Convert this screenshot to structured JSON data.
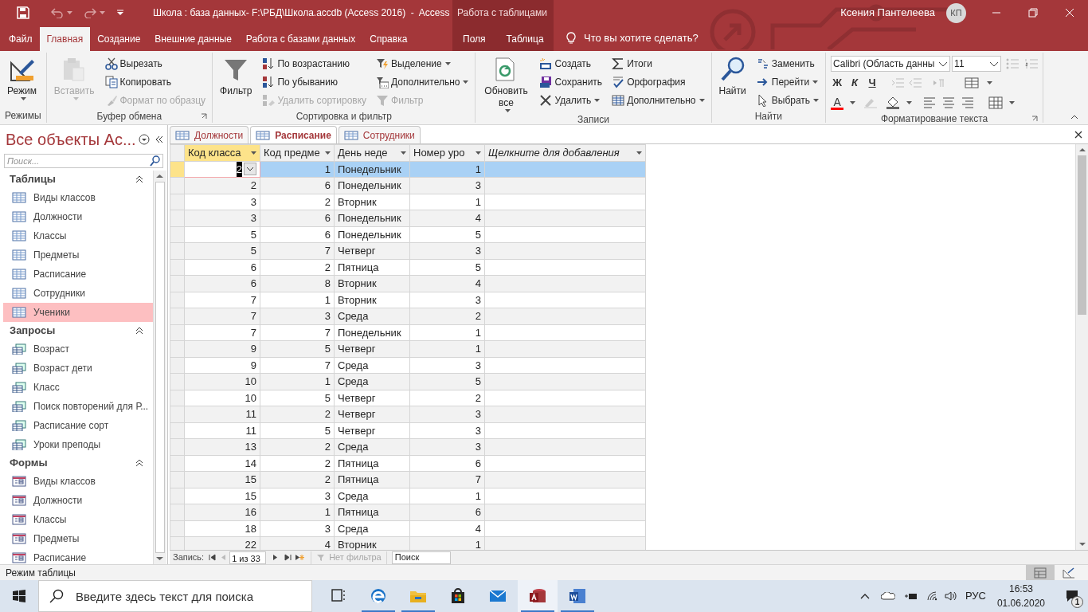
{
  "title_bar": {
    "title": "Школа : база данных- F:\\РБД\\Школа.accdb (Access 2016)  -  Access",
    "context_label": "Работа с таблицами",
    "user": "Ксения Пантелеева",
    "avatar": "КП"
  },
  "ribbon_tabs": [
    {
      "label": "Файл",
      "selected": false,
      "context": false
    },
    {
      "label": "Главная",
      "selected": true,
      "context": false
    },
    {
      "label": "Создание",
      "selected": false,
      "context": false
    },
    {
      "label": "Внешние данные",
      "selected": false,
      "context": false
    },
    {
      "label": "Работа с базами данных",
      "selected": false,
      "context": false
    },
    {
      "label": "Справка",
      "selected": false,
      "context": false
    },
    {
      "label": "Поля",
      "selected": false,
      "context": true
    },
    {
      "label": "Таблица",
      "selected": false,
      "context": true
    }
  ],
  "tell_me": "Что вы хотите сделать?",
  "ribbon_groups": [
    {
      "title": "Режимы",
      "launcher": false,
      "columns": [
        [
          {
            "label": "Режим",
            "kind": "large",
            "dropdown": true,
            "disabled": false
          }
        ]
      ]
    },
    {
      "title": "Буфер обмена",
      "launcher": true,
      "columns": [
        [
          {
            "label": "Вставить",
            "kind": "large",
            "dropdown": true,
            "disabled": true
          }
        ],
        [
          {
            "label": "Вырезать",
            "kind": "small",
            "dropdown": false,
            "disabled": false
          },
          {
            "label": "Копировать",
            "kind": "small",
            "dropdown": false,
            "disabled": false
          },
          {
            "label": "Формат по образцу",
            "kind": "small",
            "dropdown": false,
            "disabled": true
          }
        ]
      ]
    },
    {
      "title": "Сортировка и фильтр",
      "launcher": false,
      "columns": [
        [
          {
            "label": "Фильтр",
            "kind": "large",
            "dropdown": false,
            "disabled": false
          }
        ],
        [
          {
            "label": "По возрастанию",
            "kind": "small",
            "dropdown": false,
            "disabled": false
          },
          {
            "label": "По убыванию",
            "kind": "small",
            "dropdown": false,
            "disabled": false
          },
          {
            "label": "Удалить сортировку",
            "kind": "small",
            "dropdown": false,
            "disabled": true
          }
        ],
        [
          {
            "label": "Выделение",
            "kind": "small",
            "dropdown": true,
            "disabled": false
          },
          {
            "label": "Дополнительно",
            "kind": "small",
            "dropdown": true,
            "disabled": false
          },
          {
            "label": "Фильтр",
            "kind": "small",
            "dropdown": false,
            "disabled": true
          }
        ]
      ]
    },
    {
      "title": "Записи",
      "launcher": false,
      "columns": [
        [
          {
            "label": "Обновить все",
            "kind": "large",
            "dropdown": true,
            "disabled": false
          }
        ],
        [
          {
            "label": "Создать",
            "kind": "small",
            "dropdown": false,
            "disabled": false
          },
          {
            "label": "Сохранить",
            "kind": "small",
            "dropdown": false,
            "disabled": false
          },
          {
            "label": "Удалить",
            "kind": "small",
            "dropdown": true,
            "disabled": false
          }
        ],
        [
          {
            "label": "Итоги",
            "kind": "small",
            "dropdown": false,
            "disabled": false
          },
          {
            "label": "Орфография",
            "kind": "small",
            "dropdown": false,
            "disabled": false
          },
          {
            "label": "Дополнительно",
            "kind": "small",
            "dropdown": true,
            "disabled": false
          }
        ]
      ]
    },
    {
      "title": "Найти",
      "launcher": false,
      "columns": [
        [
          {
            "label": "Найти",
            "kind": "large",
            "dropdown": false,
            "disabled": false
          }
        ],
        [
          {
            "label": "Заменить",
            "kind": "small",
            "dropdown": false,
            "disabled": false
          },
          {
            "label": "Перейти",
            "kind": "small",
            "dropdown": true,
            "disabled": false
          },
          {
            "label": "Выбрать",
            "kind": "small",
            "dropdown": true,
            "disabled": false
          }
        ]
      ]
    }
  ],
  "format_group": {
    "title": "Форматирование текста",
    "launcher": true,
    "font": "Calibri (Область данны",
    "size": "11",
    "style_buttons": [
      "Ж",
      "К",
      "Ч"
    ],
    "font_color": {
      "label": "A",
      "color": "#ff0000"
    }
  },
  "navigation_pane": {
    "title": "Все объекты Ac...",
    "search_placeholder": "Поиск...",
    "groups": [
      {
        "title": "Таблицы",
        "kind": "table",
        "items": [
          {
            "label": "Виды классов",
            "selected": false
          },
          {
            "label": "Должности",
            "selected": false
          },
          {
            "label": "Классы",
            "selected": false
          },
          {
            "label": "Предметы",
            "selected": false
          },
          {
            "label": "Расписание",
            "selected": false
          },
          {
            "label": "Сотрудники",
            "selected": false
          },
          {
            "label": "Ученики",
            "selected": true
          }
        ]
      },
      {
        "title": "Запросы",
        "kind": "query",
        "items": [
          {
            "label": "Возраст",
            "selected": false
          },
          {
            "label": "Возраст дети",
            "selected": false
          },
          {
            "label": "Класс",
            "selected": false
          },
          {
            "label": "Поиск повторений для Р...",
            "selected": false
          },
          {
            "label": "Расписание сорт",
            "selected": false
          },
          {
            "label": "Уроки преподы",
            "selected": false
          }
        ]
      },
      {
        "title": "Формы",
        "kind": "form",
        "items": [
          {
            "label": "Виды классов",
            "selected": false
          },
          {
            "label": "Должности",
            "selected": false
          },
          {
            "label": "Классы",
            "selected": false
          },
          {
            "label": "Предметы",
            "selected": false
          },
          {
            "label": "Расписание",
            "selected": false
          }
        ]
      }
    ]
  },
  "document_tabs": [
    {
      "label": "Должности",
      "selected": false
    },
    {
      "label": "Расписание",
      "selected": true
    },
    {
      "label": "Сотрудники",
      "selected": false
    }
  ],
  "table": {
    "columns": [
      {
        "label": "Код класса",
        "selected": true
      },
      {
        "label": "Код предме",
        "selected": false
      },
      {
        "label": "День неде",
        "selected": false
      },
      {
        "label": "Номер уро",
        "selected": false
      },
      {
        "label": "Щелкните для добавления",
        "selected": false
      }
    ],
    "rows": [
      {
        "cells": [
          "2",
          "1",
          "Понедельник",
          "1"
        ],
        "selected": true
      },
      {
        "cells": [
          "2",
          "6",
          "Понедельник",
          "3"
        ],
        "selected": false
      },
      {
        "cells": [
          "3",
          "2",
          "Вторник",
          "1"
        ],
        "selected": false
      },
      {
        "cells": [
          "3",
          "6",
          "Понедельник",
          "4"
        ],
        "selected": false
      },
      {
        "cells": [
          "5",
          "6",
          "Понедельник",
          "5"
        ],
        "selected": false
      },
      {
        "cells": [
          "5",
          "7",
          "Четверг",
          "3"
        ],
        "selected": false
      },
      {
        "cells": [
          "6",
          "2",
          "Пятница",
          "5"
        ],
        "selected": false
      },
      {
        "cells": [
          "6",
          "8",
          "Вторник",
          "4"
        ],
        "selected": false
      },
      {
        "cells": [
          "7",
          "1",
          "Вторник",
          "3"
        ],
        "selected": false
      },
      {
        "cells": [
          "7",
          "3",
          "Среда",
          "2"
        ],
        "selected": false
      },
      {
        "cells": [
          "7",
          "7",
          "Понедельник",
          "1"
        ],
        "selected": false
      },
      {
        "cells": [
          "9",
          "5",
          "Четверг",
          "1"
        ],
        "selected": false
      },
      {
        "cells": [
          "9",
          "7",
          "Среда",
          "3"
        ],
        "selected": false
      },
      {
        "cells": [
          "10",
          "1",
          "Среда",
          "5"
        ],
        "selected": false
      },
      {
        "cells": [
          "10",
          "5",
          "Четверг",
          "2"
        ],
        "selected": false
      },
      {
        "cells": [
          "11",
          "2",
          "Четверг",
          "3"
        ],
        "selected": false
      },
      {
        "cells": [
          "11",
          "5",
          "Четверг",
          "3"
        ],
        "selected": false
      },
      {
        "cells": [
          "13",
          "2",
          "Среда",
          "3"
        ],
        "selected": false
      },
      {
        "cells": [
          "14",
          "2",
          "Пятница",
          "6"
        ],
        "selected": false
      },
      {
        "cells": [
          "15",
          "2",
          "Пятница",
          "7"
        ],
        "selected": false
      },
      {
        "cells": [
          "15",
          "3",
          "Среда",
          "1"
        ],
        "selected": false
      },
      {
        "cells": [
          "16",
          "1",
          "Пятница",
          "6"
        ],
        "selected": false
      },
      {
        "cells": [
          "18",
          "3",
          "Среда",
          "4"
        ],
        "selected": false
      },
      {
        "cells": [
          "22",
          "4",
          "Вторник",
          "1"
        ],
        "selected": false
      }
    ]
  },
  "record_navigator": {
    "label": "Запись:",
    "position": "1 из 33",
    "filter": "Нет фильтра",
    "search": "Поиск"
  },
  "status_bar": {
    "text": "Режим таблицы",
    "views": [
      {
        "selected": true
      },
      {
        "selected": false
      }
    ]
  },
  "taskbar": {
    "search_placeholder": "Введите здесь текст для поиска",
    "apps": [
      {
        "running": false,
        "selected": false
      },
      {
        "running": true,
        "selected": false
      },
      {
        "running": true,
        "selected": false
      },
      {
        "running": false,
        "selected": false
      },
      {
        "running": false,
        "selected": false
      },
      {
        "running": true,
        "selected": true
      },
      {
        "running": true,
        "selected": false
      }
    ],
    "language": "РУС",
    "time": "16:53",
    "date": "01.06.2020",
    "notifications": "1"
  }
}
